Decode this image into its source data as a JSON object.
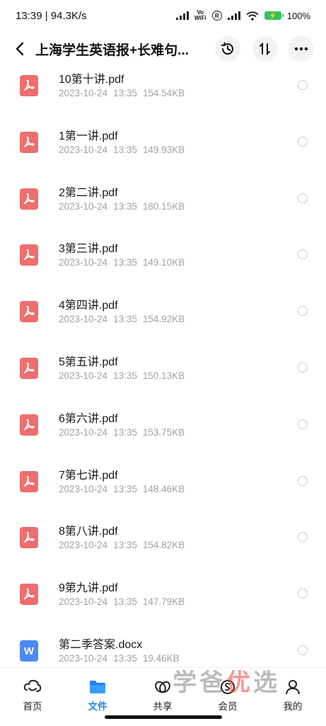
{
  "status_bar": {
    "time_speed": "13:39 | 94.3K/s",
    "vowifi_top": "Vo",
    "vowifi_bottom": "WiFi",
    "r_label": "R",
    "battery_percent": "100%",
    "battery_icon": "battery-charging-icon"
  },
  "header": {
    "title": "上海学生英语报+长难句...",
    "icons": [
      "back-icon",
      "history-icon",
      "sort-icon",
      "more-icon"
    ]
  },
  "files": [
    {
      "name": "10第十讲.pdf",
      "date": "2023-10-24",
      "time": "13:35",
      "size": "154.54KB",
      "type": "pdf"
    },
    {
      "name": "1第一讲.pdf",
      "date": "2023-10-24",
      "time": "13:35",
      "size": "149.93KB",
      "type": "pdf"
    },
    {
      "name": "2第二讲.pdf",
      "date": "2023-10-24",
      "time": "13:35",
      "size": "180.15KB",
      "type": "pdf"
    },
    {
      "name": "3第三讲.pdf",
      "date": "2023-10-24",
      "time": "13:35",
      "size": "149.10KB",
      "type": "pdf"
    },
    {
      "name": "4第四讲.pdf",
      "date": "2023-10-24",
      "time": "13:35",
      "size": "154.92KB",
      "type": "pdf"
    },
    {
      "name": "5第五讲.pdf",
      "date": "2023-10-24",
      "time": "13:35",
      "size": "150.13KB",
      "type": "pdf"
    },
    {
      "name": "6第六讲.pdf",
      "date": "2023-10-24",
      "time": "13:35",
      "size": "153.75KB",
      "type": "pdf"
    },
    {
      "name": "7第七讲.pdf",
      "date": "2023-10-24",
      "time": "13:35",
      "size": "148.46KB",
      "type": "pdf"
    },
    {
      "name": "8第八讲.pdf",
      "date": "2023-10-24",
      "time": "13:35",
      "size": "154.82KB",
      "type": "pdf"
    },
    {
      "name": "9第九讲.pdf",
      "date": "2023-10-24",
      "time": "13:35",
      "size": "147.79KB",
      "type": "pdf"
    },
    {
      "name": "第二季答案.docx",
      "date": "2023-10-24",
      "time": "13:35",
      "size": "19.46KB",
      "type": "docx",
      "icon_letter": "W"
    }
  ],
  "tabs": [
    {
      "label": "首页",
      "icon": "home-icon",
      "active": false
    },
    {
      "label": "文件",
      "icon": "folder-icon",
      "active": true
    },
    {
      "label": "共享",
      "icon": "share-icon",
      "active": false
    },
    {
      "label": "会员",
      "icon": "vip-icon",
      "active": false
    },
    {
      "label": "我的",
      "icon": "profile-icon",
      "active": false
    }
  ],
  "watermark": {
    "part1": "学爸",
    "part2": "优",
    "part3": "选"
  },
  "colors": {
    "accent": "#1d82f5",
    "pdf": "#ef6d6d",
    "docx": "#4a8af4",
    "meta": "#9ea2a8"
  }
}
